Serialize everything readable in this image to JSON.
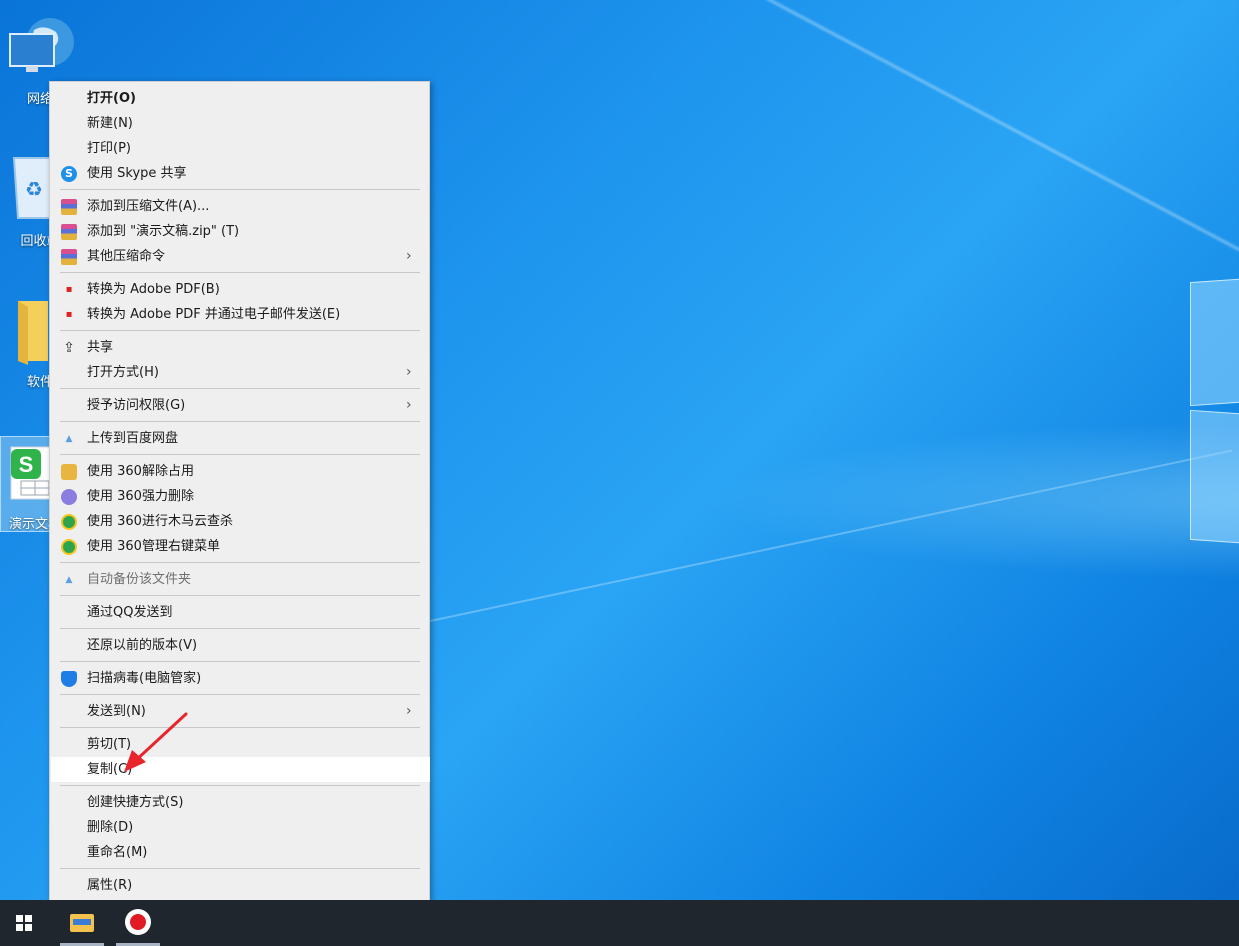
{
  "desktop": {
    "icons": [
      {
        "label": "网络",
        "icon": "network-globe-icon"
      },
      {
        "label": "回收站",
        "icon": "recycle-bin-icon"
      },
      {
        "label": "软件",
        "icon": "folder-icon"
      },
      {
        "label": "演示文稿",
        "icon": "wps-presentation-icon"
      }
    ]
  },
  "context_menu": {
    "items": [
      {
        "label": "打开(O)"
      },
      {
        "label": "新建(N)"
      },
      {
        "label": "打印(P)"
      },
      {
        "label": "使用 Skype 共享",
        "icon": "skype-icon"
      },
      {
        "label": "添加到压缩文件(A)...",
        "icon": "winrar-icon"
      },
      {
        "label": "添加到 \"演示文稿.zip\" (T)",
        "icon": "winrar-icon"
      },
      {
        "label": "其他压缩命令",
        "icon": "winrar-icon"
      },
      {
        "label": "转换为 Adobe PDF(B)",
        "icon": "adobe-pdf-icon"
      },
      {
        "label": "转换为 Adobe PDF 并通过电子邮件发送(E)",
        "icon": "adobe-pdf-icon"
      },
      {
        "label": "共享",
        "icon": "share-icon"
      },
      {
        "label": "打开方式(H)"
      },
      {
        "label": "授予访问权限(G)"
      },
      {
        "label": "上传到百度网盘",
        "icon": "baidu-netdisk-icon"
      },
      {
        "label": "使用 360解除占用",
        "icon": "360-unlock-icon"
      },
      {
        "label": "使用 360强力删除",
        "icon": "360-delete-icon"
      },
      {
        "label": "使用 360进行木马云查杀",
        "icon": "360-scan-icon"
      },
      {
        "label": "使用 360管理右键菜单",
        "icon": "360-menu-icon"
      },
      {
        "label": "自动备份该文件夹",
        "icon": "baidu-netdisk-icon"
      },
      {
        "label": "通过QQ发送到"
      },
      {
        "label": "还原以前的版本(V)"
      },
      {
        "label": "扫描病毒(电脑管家)",
        "icon": "tencent-shield-icon"
      },
      {
        "label": "发送到(N)"
      },
      {
        "label": "剪切(T)"
      },
      {
        "label": "复制(C)"
      },
      {
        "label": "创建快捷方式(S)"
      },
      {
        "label": "删除(D)"
      },
      {
        "label": "重命名(M)"
      },
      {
        "label": "属性(R)"
      }
    ],
    "submenu_arrow": "›",
    "highlighted_item": "复制(C)"
  },
  "taskbar": {
    "items": [
      {
        "icon": "windows-start-icon"
      },
      {
        "icon": "file-explorer-icon"
      },
      {
        "icon": "screen-recorder-icon"
      }
    ]
  },
  "colors": {
    "menu_bg": "#efeff0",
    "highlight_bg": "#ffffff",
    "annotation_arrow": "#e8242c",
    "taskbar_bg": "#20262e"
  }
}
